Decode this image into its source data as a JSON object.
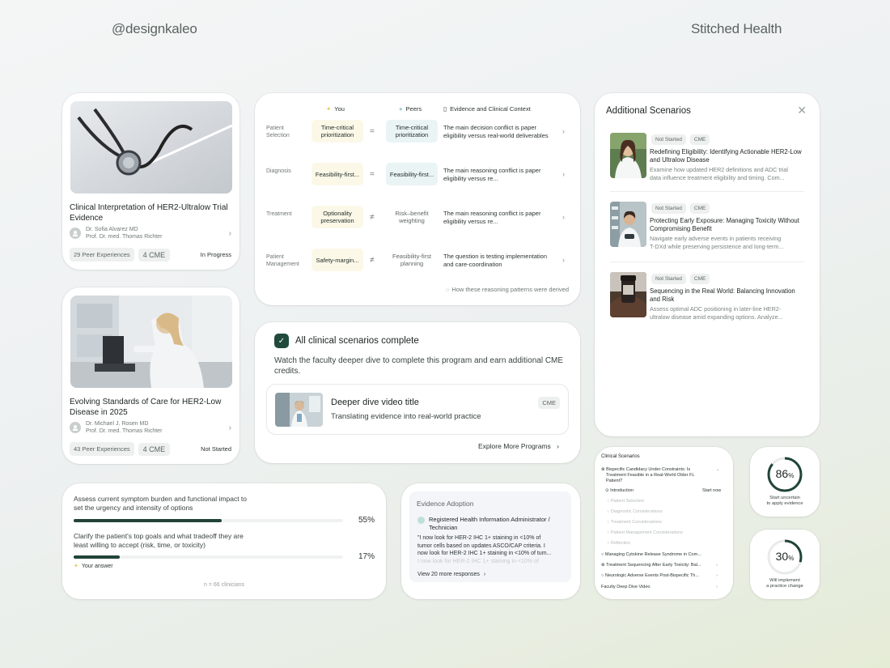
{
  "brand_left": "@designkaleo",
  "brand_right": "Stitched Health",
  "programs": [
    {
      "title": "Clinical Interpretation of HER2-Ultralow Trial Evidence",
      "author1": "Dr. Sofia Alvarez MD",
      "author2": "Prof. Dr. med. Thomas Richter",
      "peers": "29 Peer Experiences",
      "cme": "4 CME",
      "status": "In Progress",
      "image_icon": "stethoscope-image"
    },
    {
      "title": "Evolving Standards of Care for HER2-Low Disease in 2025",
      "author1": "Dr. Michael J. Rosen MD",
      "author2": "Prof. Dr. med. Thomas Richter",
      "peers": "43 Peer Experiences",
      "cme": "4 CME",
      "status": "Not Started",
      "image_icon": "lab-researcher-microscope-image"
    }
  ],
  "comparison": {
    "col_you": "You",
    "col_peers": "Peers",
    "col_context": "Evidence and Clinical Context",
    "rows": [
      {
        "label": "Patient Selection",
        "you": "Time-critical prioritization",
        "sym": "=",
        "peer": "Time-critical prioritization",
        "context": "The main decision conflict is paper eligibility versus real-world deliverables"
      },
      {
        "label": "Diagnosis",
        "you": "Feasibility-first...",
        "sym": "=",
        "peer": "Feasibility-first...",
        "context": "The main reasoning conflict is paper eligibility versus re..."
      },
      {
        "label": "Treatment",
        "you": "Optionality preservation",
        "sym": "≠",
        "peer": "Risk–benefit weighting",
        "context": "The main reasoning conflict is paper eligibility versus re..."
      },
      {
        "label": "Patient Management",
        "you": "Safety-margin...",
        "sym": "≠",
        "peer": "Feasibility-first planning",
        "context": "The question is testing implementation and care-coordination"
      }
    ],
    "note": "How these reasoning patterns were derived"
  },
  "complete": {
    "title": "All clinical scenarios complete",
    "desc": "Watch the faculty deeper dive to complete this program and earn additional CME credits.",
    "video_title": "Deeper dive video title",
    "video_sub": "Translating evidence into real-world practice",
    "badge": "CME",
    "explore": "Explore More Programs"
  },
  "additional": {
    "title": "Additional Scenarios",
    "items": [
      {
        "status": "Not Started",
        "badge": "CME",
        "title": "Redefining Eligibility: Identifying Actionable HER2-Low and Ultralow Disease",
        "desc1": "Examine how updated HER2 definitions and ADC trial",
        "desc2": "data influence treatment eligibility and timing. Com..."
      },
      {
        "status": "Not Started",
        "badge": "CME",
        "title": "Protecting Early Exposure: Managing Toxicity Without Compromising Benefit",
        "desc1": "Navigate early adverse events in patients receiving",
        "desc2": "T-DXd while preserving persistence and long-term..."
      },
      {
        "status": "Not Started",
        "badge": "CME",
        "title": "Sequencing in the Real World: Balancing Innovation and Risk",
        "desc1": "Assess optimal ADC positioning in later-line HER2-",
        "desc2": "ultralow disease amid expanding options. Analyze..."
      }
    ]
  },
  "survey": {
    "q1": "Assess current symptom burden and functional impact to set the urgency and intensity of options",
    "p1": "55%",
    "v1": 0.55,
    "q2": "Clarify the patient's top goals and what tradeoff they are least willing to accept (risk, time, or toxicity)",
    "p2": "17%",
    "v2": 0.17,
    "yours": "Your answer",
    "n": "n = 66 clinicians"
  },
  "evidence": {
    "title": "Evidence Adoption",
    "role": "Registered Health Information Administrator / Technician",
    "q1": "\"I now look for HER-2 IHC 1+ staining in <10% of",
    "q2": "tumor cells based on updates ASCO/CAP criteria. I",
    "q3": "now look for HER-2 IHC 1+ staining in <10% of tum...",
    "q4": "I now look for HER-2 IHC 1+ staining in <10% of",
    "more": "View 20 more responses"
  },
  "outline": {
    "title": "Clinical Scenarios",
    "l1": "Bispecific Candidacy Under Constraints: Is",
    "l2": "Treatment Feasible in a Real-World Older FL",
    "l3": "Patient?",
    "intro": "Introduction",
    "start": "Start now",
    "s1": "Patient Selection",
    "s2": "Diagnostic Considerations",
    "s3": "Treatment Considerations",
    "s4": "Patient Management Considerations",
    "s5": "Reflection",
    "m1": "Managing Cytokine Release Syndrome in Com...",
    "m2": "Treatment Sequencing After Early Toxicity: Bal...",
    "m3": "Neurologic Adverse Events Post-Bispecific Th...",
    "m4": "Faculty Deep Dive Video"
  },
  "rings": [
    {
      "value": "86",
      "unit": "%",
      "frac": 0.86,
      "cap1": "Start uncertain",
      "cap2": "to apply evidence"
    },
    {
      "value": "30",
      "unit": "%",
      "frac": 0.3,
      "cap1": "Will implement",
      "cap2": "a practice change"
    }
  ],
  "colors": {
    "accent": "#214437",
    "you_bg": "#fbf8e8",
    "peer_bg": "#eaf4f4"
  }
}
